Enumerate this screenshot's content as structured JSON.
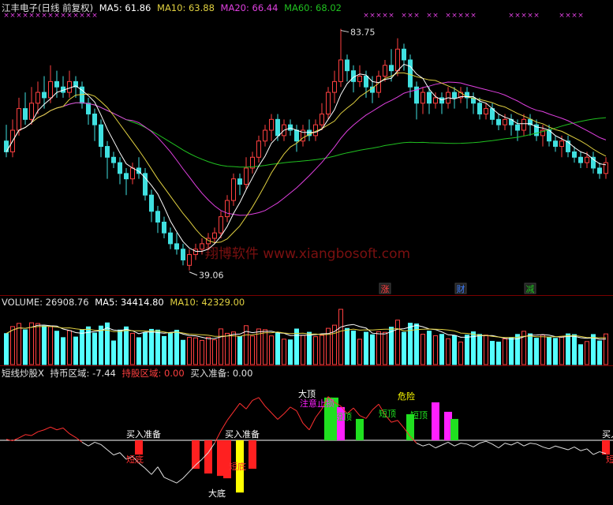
{
  "colors": {
    "up": "#ff4040",
    "down": "#40e0e0",
    "ma5": "#ffffff",
    "ma10": "#e0d040",
    "ma20": "#e040e0",
    "ma60": "#20c020",
    "text": "#e0e0e0",
    "separator": "#7a0000",
    "vol_up": "#ff4040",
    "vol_down": "#54ffff"
  },
  "price_panel": {
    "stock_title": "江丰电子(日线 前复权)",
    "ma5": "MA5: 61.86",
    "ma10": "MA10: 63.88",
    "ma20": "MA20: 66.44",
    "ma60": "MA60: 68.02",
    "high_label": "83.75",
    "low_label": "39.06",
    "watermark": "翔博软件 www.xiangbosoft.com",
    "event_badges": [
      {
        "text": "涨",
        "color": "#ff4040",
        "day": 60
      },
      {
        "text": "财",
        "color": "#4080ff",
        "day": 72
      },
      {
        "text": "减",
        "color": "#20c020",
        "day": 83
      }
    ]
  },
  "volume_panel": {
    "label": "VOLUME: 26908.76",
    "ma5": "MA5: 34414.80",
    "ma10": "MA10: 42329.00"
  },
  "indicator_panel": {
    "name": "短线炒股X",
    "hold_zone": "持币区域: -7.44",
    "holding_zone": "持股区域: 0.00",
    "buy_prepare": "买入准备: 0.00",
    "labels": {
      "buy_prepare": "买入准备",
      "short_bottom": "短底",
      "big_bottom": "大底",
      "big_top": "大顶",
      "stop_loss": "注意止损",
      "short_top": "短顶",
      "danger": "危险",
      "buy_edge": "买入"
    }
  },
  "chart_data": {
    "type": "candlestick",
    "days": 96,
    "y_price_range": [
      39.06,
      83.75
    ],
    "candles": [
      [
        63,
        61,
        66,
        60
      ],
      [
        61,
        65,
        67,
        60
      ],
      [
        65,
        69,
        71,
        64
      ],
      [
        69,
        67,
        72,
        66
      ],
      [
        67,
        70,
        73,
        66
      ],
      [
        70,
        72,
        74,
        68
      ],
      [
        72,
        71,
        75,
        69
      ],
      [
        71,
        74,
        77,
        70
      ],
      [
        74,
        73,
        76,
        71
      ],
      [
        73,
        72,
        75,
        71
      ],
      [
        72,
        74,
        76,
        71
      ],
      [
        74,
        73,
        75,
        71
      ],
      [
        73,
        70,
        74,
        69
      ],
      [
        70,
        68,
        71,
        66
      ],
      [
        68,
        66,
        69,
        63
      ],
      [
        66,
        62,
        67,
        60
      ],
      [
        62,
        60,
        63,
        56
      ],
      [
        60,
        59,
        61,
        58
      ],
      [
        59,
        57,
        60,
        55
      ],
      [
        57,
        56,
        58,
        53
      ],
      [
        56,
        58,
        59,
        55
      ],
      [
        58,
        57,
        60,
        56
      ],
      [
        57,
        53,
        58,
        52
      ],
      [
        53,
        50,
        54,
        48
      ],
      [
        50,
        48,
        51,
        46
      ],
      [
        48,
        46,
        49,
        45
      ],
      [
        46,
        44,
        47,
        43
      ],
      [
        44,
        43,
        46,
        42
      ],
      [
        43,
        41,
        44,
        40
      ],
      [
        40,
        42,
        43,
        39.06
      ],
      [
        42,
        43,
        44,
        41
      ],
      [
        43,
        44,
        45,
        42
      ],
      [
        44,
        45,
        46,
        43
      ],
      [
        45,
        46,
        47,
        44
      ],
      [
        46,
        49,
        50,
        45
      ],
      [
        49,
        52,
        53,
        48
      ],
      [
        52,
        56,
        57,
        51
      ],
      [
        56,
        55,
        57,
        53
      ],
      [
        55,
        58,
        60,
        54
      ],
      [
        58,
        60,
        61,
        57
      ],
      [
        60,
        63,
        64,
        59
      ],
      [
        63,
        65,
        66,
        62
      ],
      [
        65,
        67,
        68,
        63
      ],
      [
        67,
        64,
        68,
        63
      ],
      [
        64,
        66,
        67,
        63
      ],
      [
        66,
        65,
        67,
        64
      ],
      [
        65,
        63,
        66,
        61
      ],
      [
        63,
        65,
        66,
        62
      ],
      [
        65,
        64,
        67,
        63
      ],
      [
        64,
        66,
        67,
        63
      ],
      [
        66,
        68,
        70,
        65
      ],
      [
        68,
        72,
        73,
        67
      ],
      [
        72,
        74,
        76,
        70
      ],
      [
        74,
        78,
        83.75,
        73
      ],
      [
        78,
        76,
        79,
        74
      ],
      [
        76,
        74,
        77,
        72
      ],
      [
        74,
        75,
        77,
        73
      ],
      [
        75,
        73,
        76,
        71
      ],
      [
        73,
        72,
        75,
        70
      ],
      [
        72,
        75,
        76,
        71
      ],
      [
        75,
        77,
        78,
        74
      ],
      [
        77,
        76,
        80,
        74
      ],
      [
        76,
        80,
        82,
        75
      ],
      [
        80,
        78,
        81,
        76
      ],
      [
        78,
        73,
        79,
        71
      ],
      [
        73,
        70,
        74,
        67
      ],
      [
        70,
        72,
        73,
        68
      ],
      [
        72,
        70,
        73,
        68
      ],
      [
        70,
        71,
        72,
        69
      ],
      [
        71,
        70,
        72,
        68
      ],
      [
        70,
        72,
        73,
        69
      ],
      [
        72,
        71,
        73,
        69
      ],
      [
        71,
        72,
        73,
        70
      ],
      [
        72,
        71,
        73,
        69
      ],
      [
        71,
        70,
        72,
        68
      ],
      [
        70,
        68,
        71,
        67
      ],
      [
        68,
        69,
        70,
        67
      ],
      [
        69,
        67,
        70,
        66
      ],
      [
        67,
        66,
        68,
        65
      ],
      [
        66,
        67,
        68,
        65
      ],
      [
        67,
        66,
        68,
        64
      ],
      [
        66,
        65,
        67,
        63
      ],
      [
        65,
        67,
        68,
        64
      ],
      [
        67,
        66,
        68,
        64
      ],
      [
        66,
        64,
        67,
        63
      ],
      [
        64,
        65,
        66,
        62
      ],
      [
        65,
        63,
        66,
        62
      ],
      [
        63,
        62,
        64,
        61
      ],
      [
        62,
        63,
        64,
        60
      ],
      [
        63,
        61,
        64,
        60
      ],
      [
        61,
        60,
        62,
        59
      ],
      [
        60,
        59,
        61,
        58
      ],
      [
        59,
        60,
        61,
        58
      ],
      [
        60,
        58,
        61,
        57
      ],
      [
        58,
        57,
        59,
        56
      ],
      [
        57,
        59,
        60,
        56
      ]
    ],
    "indicator": [
      0.2,
      -0.1,
      0.5,
      1.2,
      1.0,
      1.8,
      2.2,
      2.8,
      2.2,
      2.6,
      1.4,
      0.6,
      -0.4,
      -1.2,
      -0.4,
      -0.9,
      -2.0,
      -3.1,
      -2.6,
      -4.0,
      -3.4,
      -4.8,
      -5.9,
      -7.2,
      -5.6,
      -7.8,
      -8.4,
      -9.0,
      -8.0,
      -6.6,
      -5.2,
      -4.0,
      -2.6,
      -0.6,
      2.0,
      4.2,
      6.0,
      7.8,
      6.6,
      8.4,
      9.0,
      7.2,
      5.8,
      4.4,
      5.6,
      7.0,
      6.2,
      3.6,
      2.2,
      4.8,
      6.6,
      9.2,
      8.0,
      7.2,
      5.6,
      6.8,
      5.2,
      4.6,
      6.4,
      7.6,
      5.4,
      3.8,
      4.2,
      2.6,
      0.8,
      -0.6,
      -1.2,
      -0.8,
      -1.6,
      -1.0,
      -0.4,
      -1.2,
      -0.6,
      -0.8,
      -1.4,
      -0.6,
      -0.2,
      -0.8,
      -1.6,
      -0.6,
      -1.0,
      -0.4,
      -1.2,
      -0.6,
      -0.8,
      -1.4,
      -1.8,
      -1.2,
      -1.6,
      -2.0,
      -1.4,
      -2.2,
      -1.8,
      -3.0,
      -2.4,
      -2.8
    ],
    "indicator_range": [
      -12,
      12
    ],
    "indicator_bars": [
      {
        "day": 21,
        "kind": "short-bottom",
        "color": "#ff2020",
        "h": -3
      },
      {
        "day": 30,
        "kind": "red",
        "color": "#ff2020",
        "h": -6
      },
      {
        "day": 32,
        "kind": "red",
        "color": "#ff2020",
        "h": -7
      },
      {
        "day": 34,
        "kind": "red",
        "color": "#ff2020",
        "h": -7.5
      },
      {
        "day": 35,
        "kind": "red",
        "color": "#ff2020",
        "h": -8
      },
      {
        "day": 37,
        "kind": "big-bottom",
        "color": "#ffff00",
        "h": -11
      },
      {
        "day": 39,
        "kind": "red",
        "color": "#ff2020",
        "h": -6
      },
      {
        "day": 51,
        "kind": "big-top",
        "color": "#20e020",
        "h": 9
      },
      {
        "day": 52,
        "kind": "green",
        "color": "#20e020",
        "h": 9
      },
      {
        "day": 53,
        "kind": "magenta",
        "color": "#ff20ff",
        "h": 7
      },
      {
        "day": 56,
        "kind": "short-top",
        "color": "#20e020",
        "h": 4.5
      },
      {
        "day": 64,
        "kind": "short-top",
        "color": "#20e020",
        "h": 5.5
      },
      {
        "day": 68,
        "kind": "danger",
        "color": "#ff20ff",
        "h": 8
      },
      {
        "day": 70,
        "kind": "magenta",
        "color": "#ff20ff",
        "h": 6
      },
      {
        "day": 71,
        "kind": "short-top",
        "color": "#20e020",
        "h": 4.5
      },
      {
        "day": 95,
        "kind": "short-bottom",
        "color": "#ff2020",
        "h": -3
      }
    ]
  }
}
